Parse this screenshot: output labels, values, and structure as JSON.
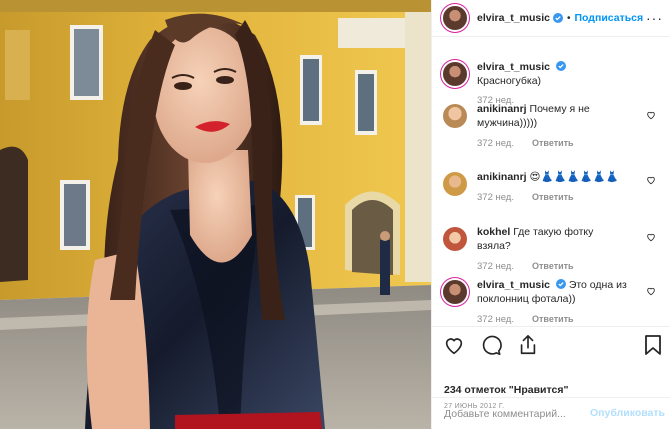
{
  "post": {
    "username": "elvira_t_music",
    "follow_label": "Подписаться",
    "separator": "•",
    "more_label": "···"
  },
  "comments": [
    {
      "user": "elvira_t_music",
      "text": "Красногубка)",
      "time": "372 нед.",
      "reply": ""
    },
    {
      "user": "anikinanrj",
      "text": "Почему я не мужчина)))))",
      "time": "372 нед.",
      "reply": "Ответить"
    },
    {
      "user": "anikinanrj",
      "text": "😍👗👗👗👗👗👗",
      "time": "372 нед.",
      "reply": "Ответить"
    },
    {
      "user": "kokhel",
      "text": "Где такую фотку взяла?",
      "time": "372 нед.",
      "reply": "Ответить"
    },
    {
      "user": "elvira_t_music",
      "text": "Это одна из поклонниц фотала))",
      "time": "372 нед.",
      "reply": "Ответить"
    }
  ],
  "actions": {
    "likes_text": "234 отметок \"Нравится\"",
    "date_text": "27 ИЮНЬ 2012 Г."
  },
  "comment_box": {
    "placeholder": "Добавьте комментарий...",
    "publish_label": "Опубликовать"
  },
  "colors": {
    "accent": "#0095f6",
    "muted": "#8e8e8e",
    "text": "#262626",
    "lipstick": "#d4222c"
  },
  "icons": [
    "verified-icon",
    "more-options-icon",
    "heart-icon",
    "comment-icon",
    "share-icon",
    "bookmark-icon"
  ]
}
